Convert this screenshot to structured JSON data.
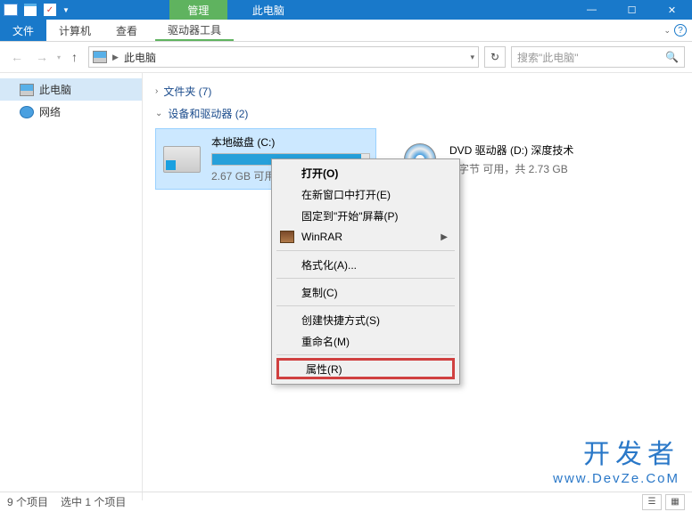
{
  "titlebar": {
    "contextual_tab": "管理",
    "title": "此电脑",
    "window_buttons": {
      "min": "—",
      "max": "☐",
      "close": "✕"
    }
  },
  "ribbon": {
    "file": "文件",
    "computer": "计算机",
    "view": "查看",
    "drive_tools": "驱动器工具"
  },
  "address": {
    "crumb": "此电脑",
    "search_placeholder": "搜索\"此电脑\""
  },
  "sidebar": {
    "this_pc": "此电脑",
    "network": "网络"
  },
  "groups": {
    "folders": "文件夹 (7)",
    "devices": "设备和驱动器 (2)"
  },
  "drives": {
    "c": {
      "name": "本地磁盘 (C:)",
      "status": "2.67 GB 可用",
      "fill_pct": 95
    },
    "d": {
      "name": "DVD 驱动器 (D:) 深度技术",
      "status": "0 字节 可用，共 2.73 GB"
    }
  },
  "context_menu": {
    "open": "打开(O)",
    "open_new_window": "在新窗口中打开(E)",
    "pin_to_start": "固定到\"开始\"屏幕(P)",
    "winrar": "WinRAR",
    "format": "格式化(A)...",
    "copy": "复制(C)",
    "create_shortcut": "创建快捷方式(S)",
    "rename": "重命名(M)",
    "properties": "属性(R)"
  },
  "statusbar": {
    "items": "9 个项目",
    "selected": "选中 1 个项目"
  },
  "watermark": {
    "line1": "开发者",
    "line2": "www.DevZe.CoM"
  }
}
